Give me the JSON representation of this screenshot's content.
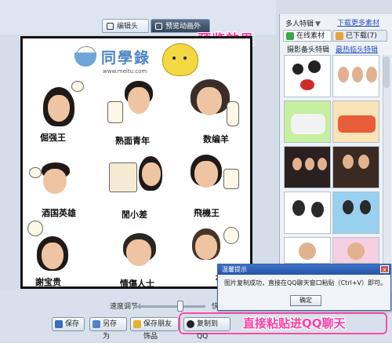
{
  "tabs": {
    "edit_label": "编辑头像",
    "preview_label": "预览动画外观"
  },
  "annotations": {
    "preview_effect": "预览效果",
    "paste_chat": "直接粘贴进QQ聊天"
  },
  "canvas": {
    "logo_title": "同學錄",
    "logo_url": "www.meitu.com",
    "captions": [
      "倔强王",
      "熟面青年",
      "数编羊",
      "酒国英雄",
      "閒小差",
      "飛機王",
      "謝宝贵",
      "情傷人士",
      "夜生"
    ]
  },
  "right_panel": {
    "multi_label": "多人特辑",
    "download_link": "下载更多素材",
    "tab_online": "在线素材",
    "tab_downloaded": "已下载(7)",
    "sub_tab_1": "摄影备头特辑",
    "sub_tab_2": "最热临头特辑"
  },
  "dialog": {
    "title": "温馨提示",
    "message": "图片复制成功，直接在QQ聊天窗口粘贴（Ctrl+V）即可。",
    "ok_label": "确定",
    "close_glyph": "x"
  },
  "bottom": {
    "size_label": "速度调节：",
    "size_value": "快",
    "save_label": "保存",
    "save_as_label": "另存为",
    "save_exchange_label": "保存朋友饰品",
    "copy_label": "复制到QQ"
  },
  "colors": {
    "accent_pink": "#ff3aa6",
    "dialog_titlebar": "#2455a6",
    "link_blue": "#2a4fc0"
  },
  "icons": {
    "edit_tab": "edit-icon",
    "preview_tab": "monitor-icon",
    "online": "cloud-icon",
    "downloaded": "folder-icon",
    "save": "floppy-icon",
    "save_as": "save-as-icon",
    "save_exchange": "star-icon",
    "copy": "qq-penguin-icon"
  }
}
